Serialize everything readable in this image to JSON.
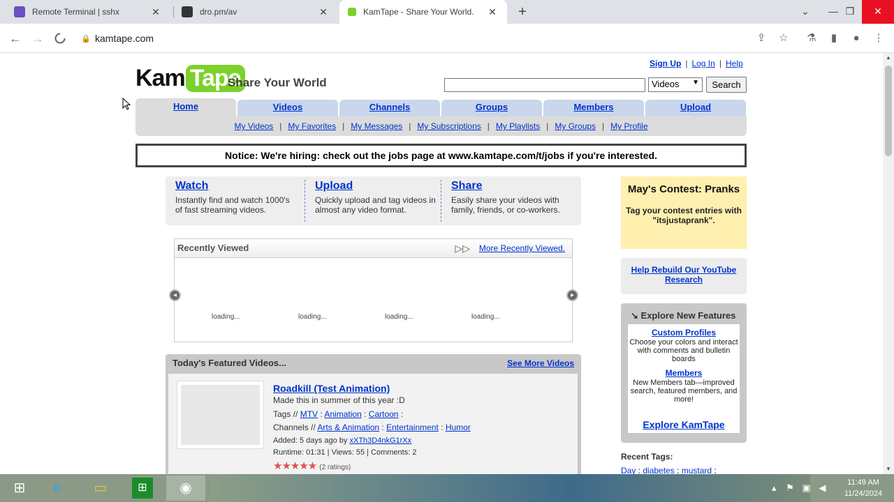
{
  "browser": {
    "tabs": [
      {
        "title": "Remote Terminal | sshx",
        "favicon": "sshx-icon"
      },
      {
        "title": "dro.pm/av",
        "favicon": "dro-icon"
      },
      {
        "title": "KamTape - Share Your World.",
        "favicon": "kamtape-icon",
        "active": true
      }
    ],
    "url": "kamtape.com"
  },
  "site": {
    "logo_kam": "Kam",
    "logo_tape": "Tape",
    "tagline": "Share Your World",
    "top_links": [
      "Sign Up",
      "Log In",
      "Help"
    ],
    "search_select": "Videos",
    "search_button": "Search",
    "nav_tabs": [
      "Home",
      "Videos",
      "Channels",
      "Groups",
      "Members",
      "Upload"
    ],
    "sub_nav": [
      "My Videos",
      "My Favorites",
      "My Messages",
      "My Subscriptions",
      "My Playlists",
      "My Groups",
      "My Profile"
    ],
    "notice": "Notice: We're hiring: check out the jobs page at www.kamtape.com/t/jobs if you're interested.",
    "wus": [
      {
        "title": "Watch",
        "desc": "Instantly find and watch 1000's of fast streaming videos."
      },
      {
        "title": "Upload",
        "desc": "Quickly upload and tag videos in almost any video format."
      },
      {
        "title": "Share",
        "desc": "Easily share your videos with family, friends, or co-workers."
      }
    ],
    "recently_viewed": {
      "title": "Recently Viewed",
      "more": "More Recently Viewed.",
      "loading": [
        "loading...",
        "loading...",
        "loading...",
        "loading..."
      ]
    },
    "featured": {
      "title": "Today's Featured Videos...",
      "more": "See More Videos",
      "video": {
        "title": "Roadkill (Test Animation)",
        "desc": "Made this in summer of this year :D",
        "tags_label": "Tags //",
        "tags": [
          "MTV",
          "Animation",
          "Cartoon"
        ],
        "channels_label": "Channels //",
        "channels": [
          "Arts & Animation",
          "Entertainment",
          "Humor"
        ],
        "added_prefix": "Added: 5 days ago by",
        "author": "xXTh3D4nkG1rXx",
        "stats": "Runtime: 01:31 | Views: 55 | Comments: 2",
        "stars": 5,
        "ratings": "(2 ratings)"
      }
    },
    "contest": {
      "title": "May's Contest: Pranks",
      "desc": "Tag your contest entries with \"itsjustaprank\"."
    },
    "rebuild": "Help Rebuild Our YouTube Research",
    "explore": {
      "title": "Explore New Features",
      "features": [
        {
          "name": "Custom Profiles",
          "desc": "Choose your colors and interact with comments and bulletin boards"
        },
        {
          "name": "Members",
          "desc": "New Members tab—improved search, featured members, and more!"
        }
      ],
      "cta": "Explore KamTape"
    },
    "recent_tags": {
      "title": "Recent Tags:",
      "tags": [
        "Day",
        "diabetes",
        "mustard"
      ]
    }
  },
  "taskbar": {
    "time": "11:49 AM",
    "date": "11/24/2024"
  }
}
